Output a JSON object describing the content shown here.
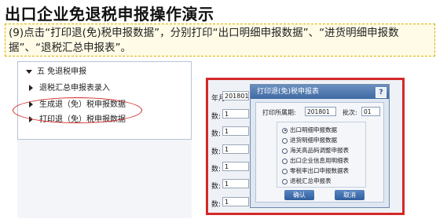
{
  "slide": {
    "title": "出口企业免退税申报操作演示",
    "instruction": "(9)点击“打印退(免)税申报数据”，分别打印“出口明细申报数据”、“进货明细申报数据”、“退税汇总申报表”。"
  },
  "tree": {
    "header": "五  免退税申报",
    "items": [
      "退税汇总申报表录入",
      "生成退（免）税申报数据",
      "打印退（免）税申报数据"
    ]
  },
  "background_form": {
    "labels": [
      "年月:",
      "数:",
      "数:",
      "数:",
      "数:",
      "数:",
      "数:"
    ],
    "period_value": "201801",
    "count_values": [
      "1",
      "1",
      "1",
      "1",
      "1",
      "1"
    ]
  },
  "dialog": {
    "title": "打印退(免)税申报表",
    "help": "?",
    "period_label": "打印所属期:",
    "period_value": "201801",
    "batch_label": "批次:",
    "batch_value": "01",
    "options": [
      "出口明细申报数据",
      "进货明细申报数据",
      "海关高品码调整申报表",
      "出口企业信息用明细表",
      "零税率出口申报数据表",
      "退税汇总申报表"
    ],
    "selected_index": 0,
    "confirm_label": "确认",
    "cancel_label": "取消"
  },
  "colors": {
    "highlight_red": "#d42828",
    "dialog_title_blue": "#3f6aa3",
    "instruction_border": "#d8b100"
  }
}
